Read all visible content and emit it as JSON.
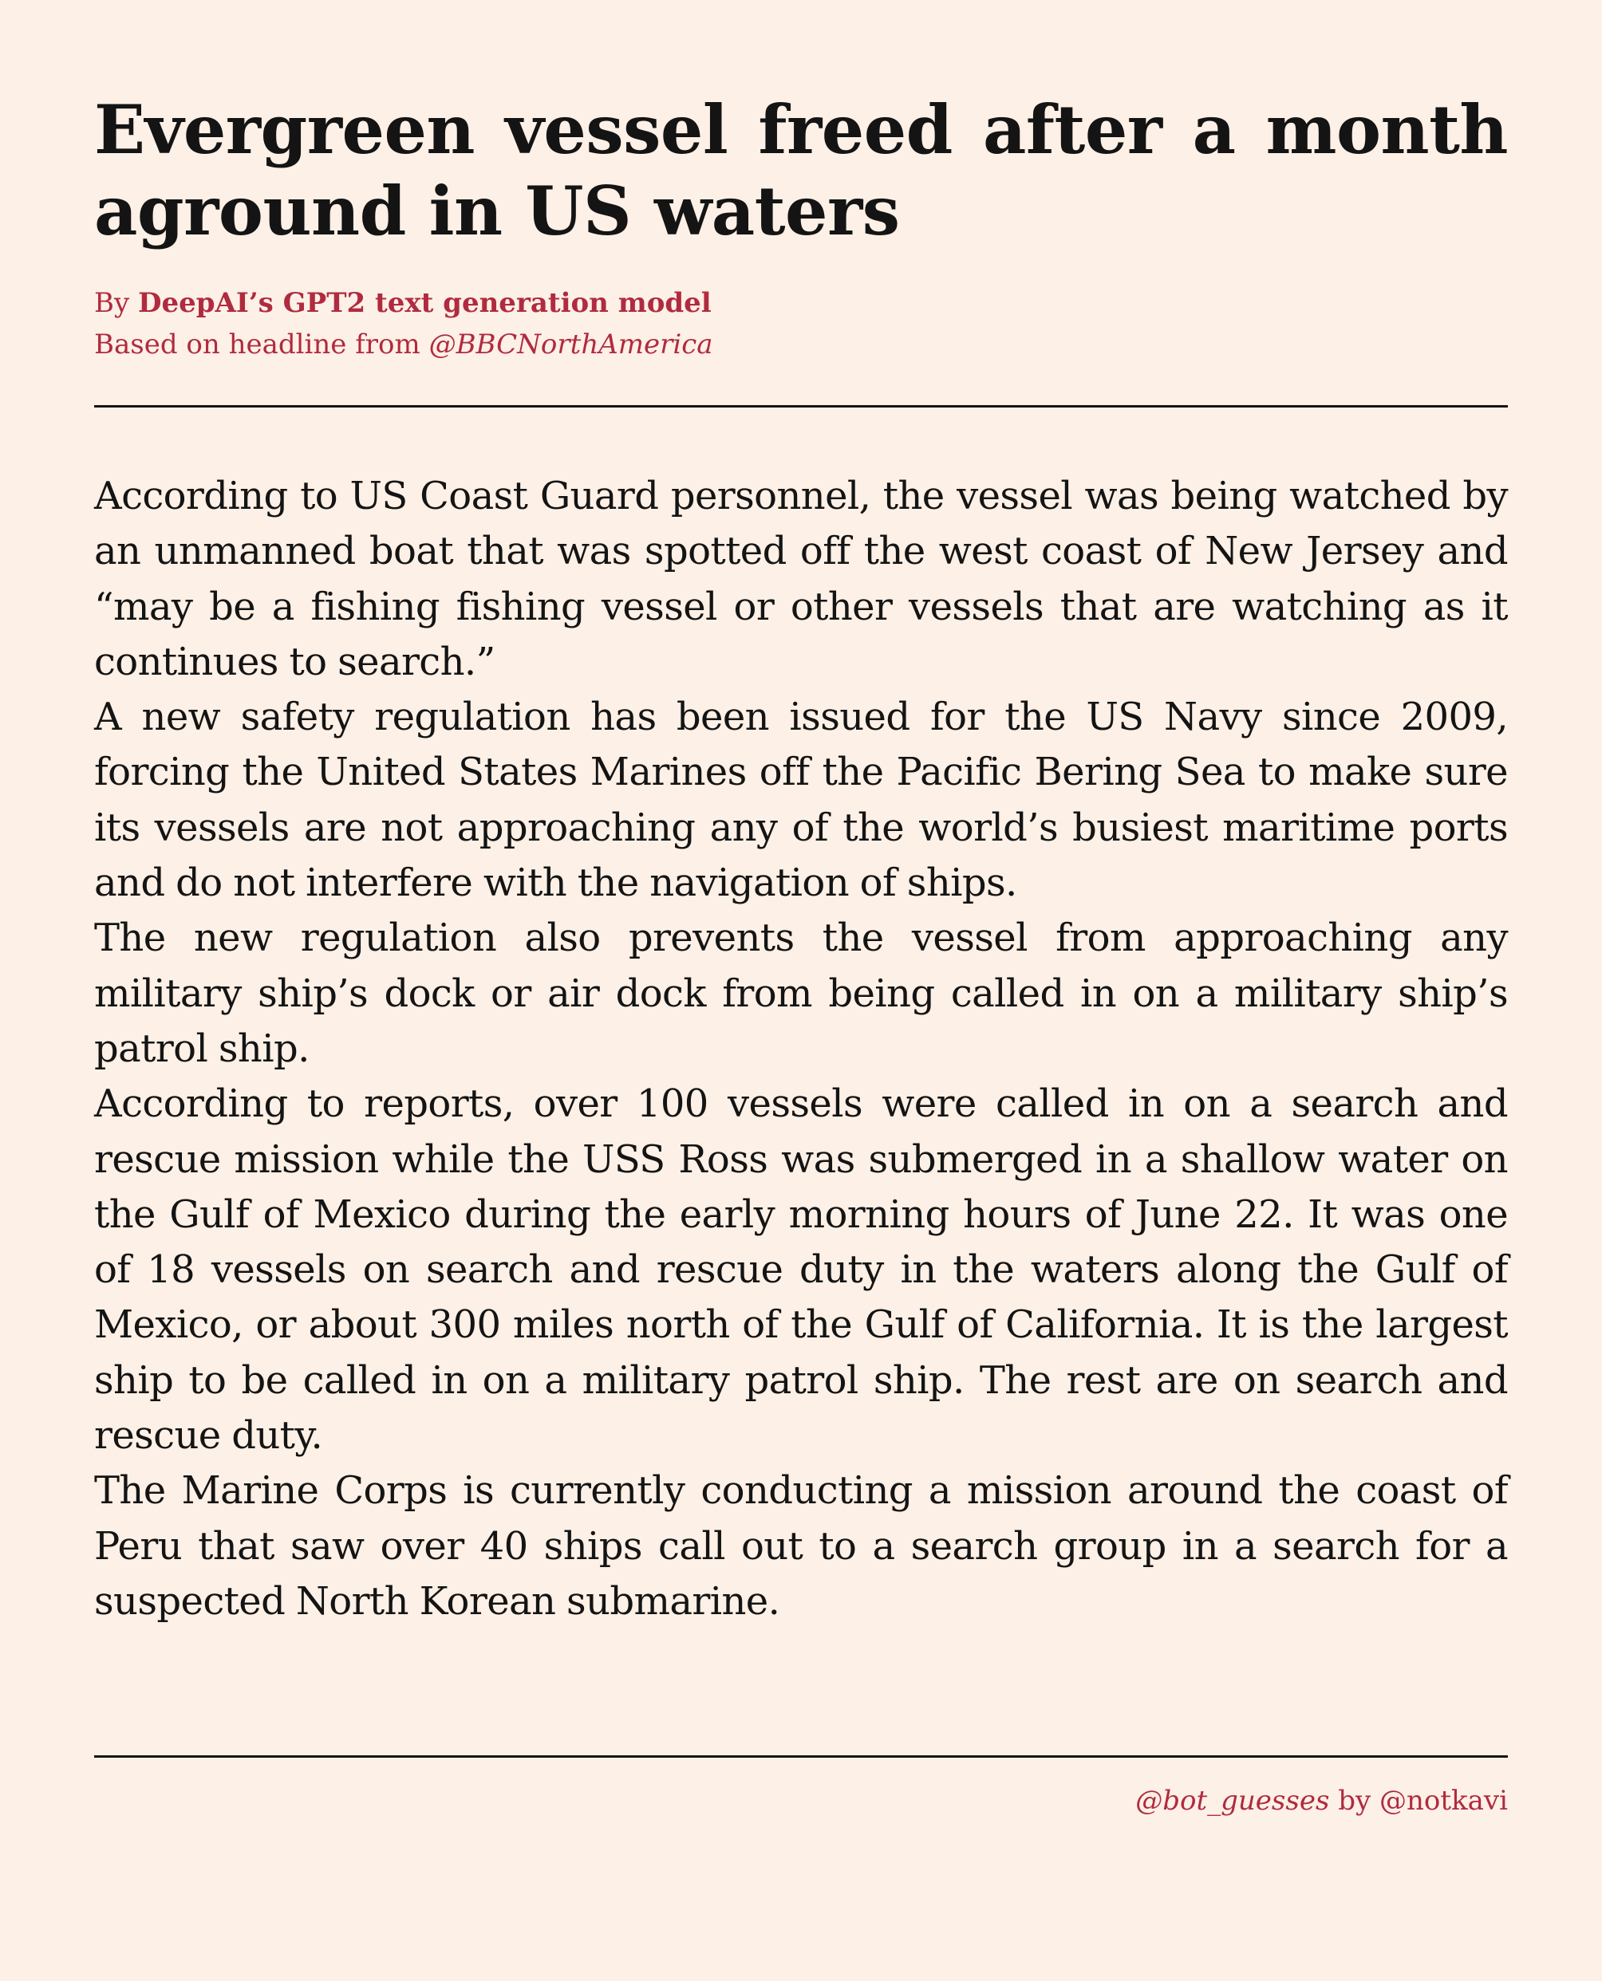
{
  "article": {
    "headline": "Evergreen vessel freed after a month aground in US waters",
    "byline_prefix": "By ",
    "byline_author": "DeepAI’s GPT2 text generation model",
    "based_on_prefix": "Based on headline from ",
    "based_on_handle": "@BBCNorthAmerica",
    "paragraphs": [
      "According to US Coast Guard personnel, the vessel was being watched by an unmanned boat that was spotted off the west coast of New Jersey and “may be a fishing fishing vessel or other vessels that are watching as it continues to search.”",
      "A new safety regulation has been issued for the US Navy since 2009, forcing the United States Marines off the Pacific Bering Sea to make sure its vessels are not approaching any of the world’s busiest maritime ports and do not interfere with the navigation of ships.",
      "The new regulation also prevents the vessel from approaching any military ship’s dock or air dock from being called in on a military ship’s patrol ship.",
      "According to reports, over 100 vessels were called in on a search and rescue mission while the USS Ross was submerged in a shallow water on the Gulf of Mexico during the early morning hours of June 22. It was one of 18 vessels on search and rescue duty in the waters along the Gulf of Mexico, or about 300 miles north of the Gulf of California.  It is the largest ship to be called in on a military patrol ship. The rest are on search and rescue duty.",
      "The Marine Corps is currently conducting a mission around the coast of Peru that saw over 40 ships call out to a search group in a search for a suspected North Korean submarine."
    ]
  },
  "footer": {
    "bot_handle": "@bot_guesses",
    "by_text": " by ",
    "author_handle": "@notkavi"
  },
  "colors": {
    "background": "#fdf0e6",
    "text": "#141414",
    "accent": "#b02b3f"
  }
}
